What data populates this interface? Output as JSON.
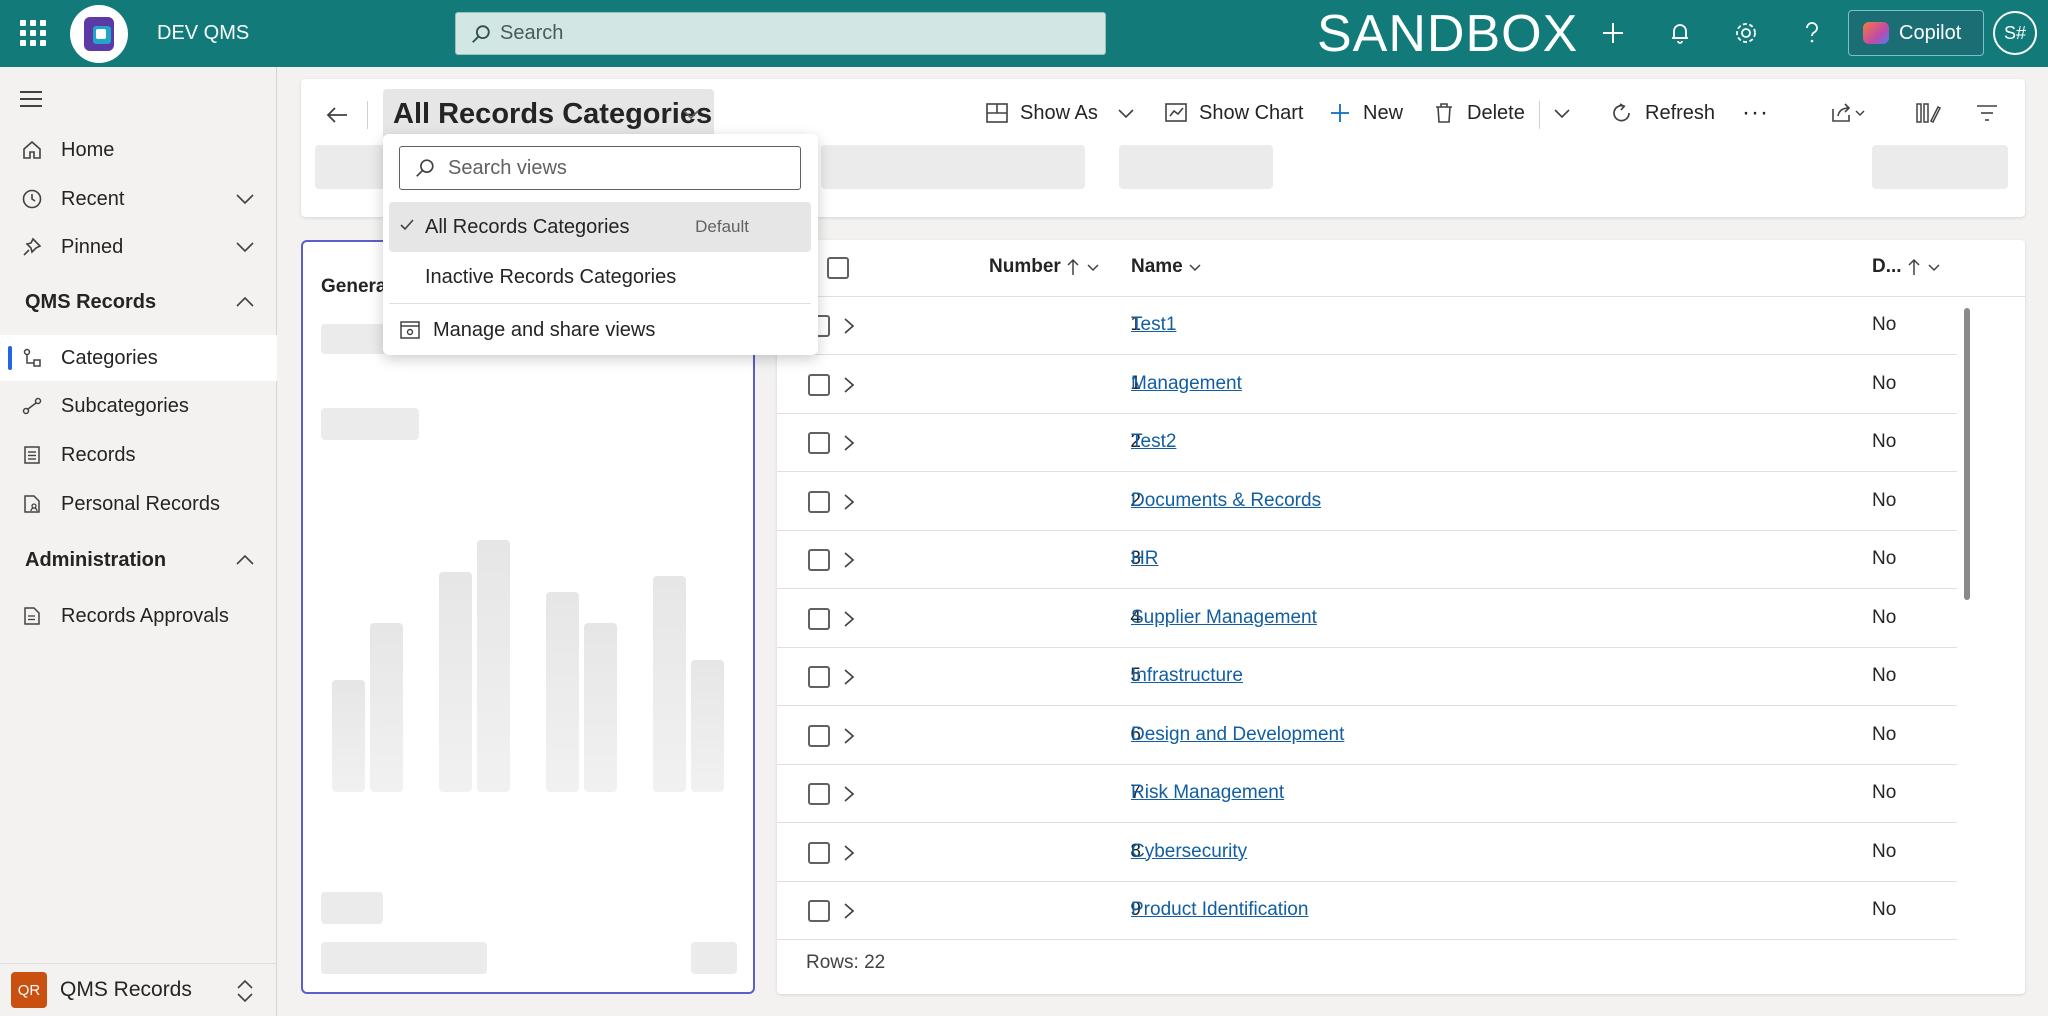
{
  "topbar": {
    "app_name": "DEV QMS",
    "search_placeholder": "Search",
    "environment_label": "SANDBOX",
    "copilot_label": "Copilot",
    "user_initials": "S#",
    "accent_color": "#127b7a"
  },
  "sidebar": {
    "items": [
      {
        "label": "Home",
        "icon": "home-icon"
      },
      {
        "label": "Recent",
        "icon": "clock-icon"
      },
      {
        "label": "Pinned",
        "icon": "pin-icon"
      }
    ],
    "sections": [
      {
        "title": "QMS Records",
        "items": [
          {
            "label": "Categories",
            "icon": "hierarchy-icon",
            "active": true
          },
          {
            "label": "Subcategories",
            "icon": "subcategory-icon"
          },
          {
            "label": "Records",
            "icon": "list-icon"
          },
          {
            "label": "Personal Records",
            "icon": "personal-doc-icon"
          }
        ]
      },
      {
        "title": "Administration",
        "items": [
          {
            "label": "Records Approvals",
            "icon": "approval-doc-icon"
          }
        ]
      }
    ],
    "area_switcher": {
      "badge": "QR",
      "label": "QMS Records"
    }
  },
  "commandbar": {
    "view_title": "All Records Categories",
    "show_as": "Show As",
    "show_chart": "Show Chart",
    "new": "New",
    "delete": "Delete",
    "refresh": "Refresh",
    "more": "···"
  },
  "view_dropdown": {
    "search_placeholder": "Search views",
    "views": [
      {
        "label": "All Records Categories",
        "selected": true,
        "badge": "Default"
      },
      {
        "label": "Inactive Records Categories",
        "selected": false,
        "badge": ""
      }
    ],
    "manage_label": "Manage and share views"
  },
  "chart": {
    "title_visible": "Genera"
  },
  "grid": {
    "columns": {
      "number": "Number",
      "name": "Name",
      "d": "D..."
    },
    "rows": [
      {
        "number": "1",
        "name": "Test1",
        "d": "No"
      },
      {
        "number": "1",
        "name": "Management",
        "d": "No"
      },
      {
        "number": "2",
        "name": "Test2",
        "d": "No"
      },
      {
        "number": "2",
        "name": "Documents & Records",
        "d": "No"
      },
      {
        "number": "3",
        "name": "HR",
        "d": "No"
      },
      {
        "number": "4",
        "name": "Supplier Management",
        "d": "No"
      },
      {
        "number": "5",
        "name": "Infrastructure",
        "d": "No"
      },
      {
        "number": "6",
        "name": "Design and Development",
        "d": "No"
      },
      {
        "number": "7",
        "name": "Risk Management",
        "d": "No"
      },
      {
        "number": "8",
        "name": "Cybersecurity",
        "d": "No"
      },
      {
        "number": "9",
        "name": "Product Identification",
        "d": "No"
      }
    ],
    "rows_footer": "Rows: 22"
  }
}
